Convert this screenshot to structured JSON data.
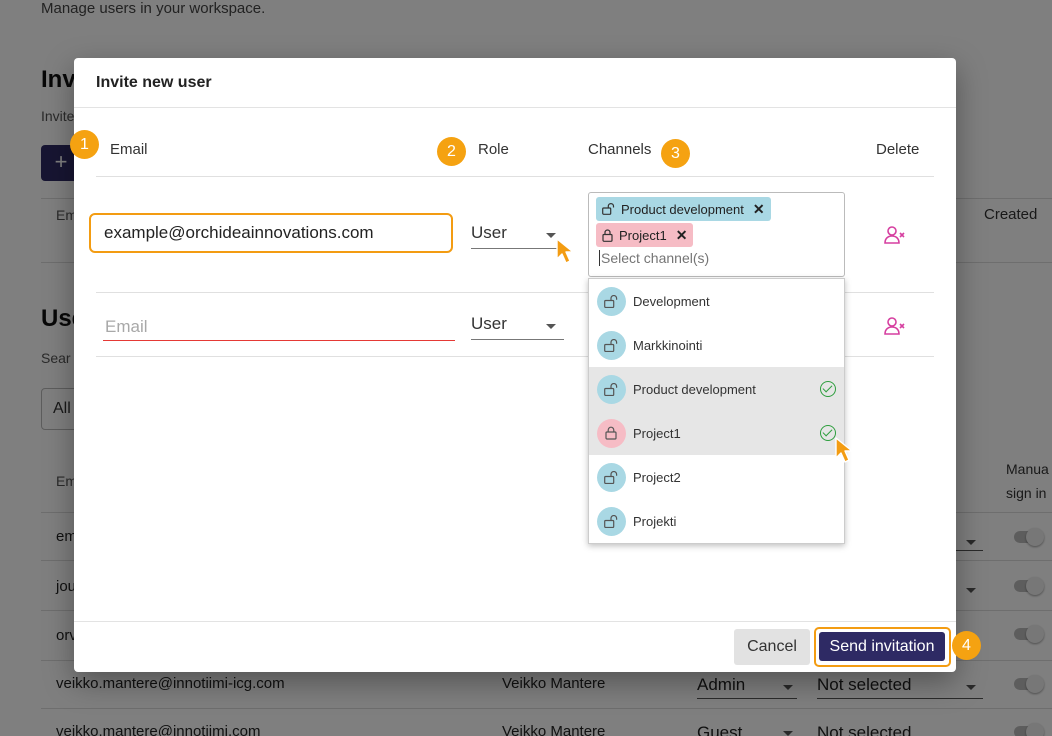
{
  "background": {
    "subtitle": "Manage users in your workspace.",
    "invite_heading": "Inv",
    "invite_text": "Invite",
    "add_button": "+",
    "invite_col_email": "Em",
    "invite_col_created": "Created",
    "users_heading": "Use",
    "search_label": "Sear",
    "filter_value": "All",
    "users_col_email": "Em",
    "users_col_manual": "Manua",
    "users_col_manual2": "sign in",
    "rows": [
      {
        "email": "em"
      },
      {
        "email": "jou"
      },
      {
        "email": "orv"
      },
      {
        "email": "veikko.mantere@innotiimi-icg.com",
        "name": "Veikko Mantere",
        "role": "Admin",
        "selection": "Not selected"
      },
      {
        "email": "veikko.mantere@innotiimi.com",
        "name": "Veikko Mantere",
        "role": "Guest",
        "selection": "Not selected"
      }
    ]
  },
  "modal": {
    "title": "Invite new user",
    "columns": {
      "email": "Email",
      "role": "Role",
      "channels": "Channels",
      "delete": "Delete"
    },
    "row1": {
      "email_value": "example@orchideainnovations.com",
      "role": "User",
      "chips": [
        {
          "label": "Product development",
          "color": "#a9d8e4",
          "remove": "✕"
        },
        {
          "label": "Project1",
          "color": "#f6bcc5",
          "remove": "✕"
        }
      ],
      "channel_placeholder": "Select channel(s)"
    },
    "row2": {
      "email_placeholder": "Email",
      "role": "User"
    },
    "dropdown": [
      {
        "label": "Development",
        "selected": false,
        "color": "blue"
      },
      {
        "label": "Markkinointi",
        "selected": false,
        "color": "blue"
      },
      {
        "label": "Product development",
        "selected": true,
        "color": "blue"
      },
      {
        "label": "Project1",
        "selected": true,
        "color": "pink"
      },
      {
        "label": "Project2",
        "selected": false,
        "color": "blue"
      },
      {
        "label": "Projekti",
        "selected": false,
        "color": "blue"
      }
    ],
    "cancel_label": "Cancel",
    "send_label": "Send invitation"
  },
  "badges": [
    "1",
    "2",
    "3",
    "4"
  ],
  "colors": {
    "accent": "#f5a211",
    "primary": "#2e2a64",
    "channel_blue": "#a9d8e4",
    "channel_pink": "#f6bcc5",
    "delete_icon": "#d63fa0",
    "check": "#2e9e3e"
  }
}
